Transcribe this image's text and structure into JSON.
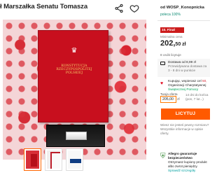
{
  "header": {
    "title": "ł Marszałka Senatu Tomasza"
  },
  "seller": {
    "name": "od WOSP_Konopnicka",
    "rating": "poleca 100%"
  },
  "auction": {
    "badge": "10. Finał WOŚP",
    "min_label": "Minimalna cena",
    "price_main": "202,",
    "price_cents": "50 zł",
    "bids": "8 osób licytuje"
  },
  "delivery": {
    "label": "Dostawa od 8,99 zł",
    "detail": "Przewidywana dostawa za 3 - 8 dni w punkcie"
  },
  "charity": {
    "line1": "Kupując, wspierasz cel ",
    "amount": "50,",
    "line2": " Organizacji Charytatywnej",
    "line3": "Świątecznej Pomocy"
  },
  "offer": {
    "label": "Twoja oferta",
    "value": "205,00",
    "unit": "zł",
    "info": "14 dni do końca (pon, 7 lut...)"
  },
  "buttons": {
    "bid": "LICYTUJ"
  },
  "note": {
    "text": "Wiesz nie jesteś pewny rozmiaru? Wszystkie informacje w opisie oferty."
  },
  "protection": {
    "bold": "Allegro gwarantuje bezpieczeństwo",
    "text": "Otrzymasz kupiony produkt albo zwrot pieniędzy. ",
    "link": "Sprawdź szczegóły"
  },
  "colors": {
    "accent": "#ff5a00",
    "charity_red": "#d61d2b",
    "success_green": "#0c8a72"
  },
  "icons": {
    "share": "share-icon",
    "favorite": "heart-icon",
    "delivery": "truck-icon",
    "charity": "heart-icon",
    "protection": "shield-icon"
  }
}
